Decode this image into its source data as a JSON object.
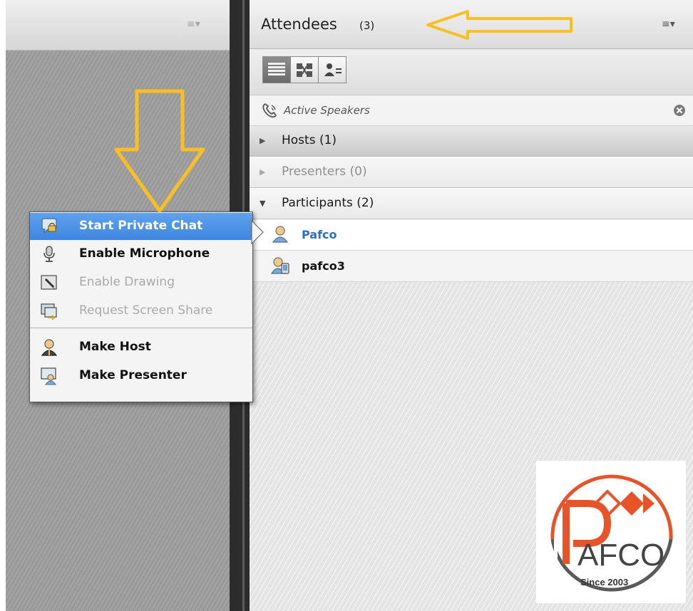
{
  "left_pod": {
    "menu_icon": "pod-menu-icon"
  },
  "attendees_pod": {
    "title": "Attendees",
    "count": "(3)",
    "menu_icon": "pod-menu-icon",
    "view_buttons": [
      "list-view-icon",
      "breakout-view-icon",
      "status-view-icon"
    ],
    "active_speakers": {
      "label": "Active Speakers",
      "icon": "phone-icon",
      "close_icon": "close-icon"
    },
    "groups": [
      {
        "label": "Hosts (1)",
        "expanded": false
      },
      {
        "label": "Presenters (0)",
        "expanded": false,
        "disabled": true
      },
      {
        "label": "Participants (2)",
        "expanded": true
      }
    ],
    "participants": [
      {
        "name": "Pafco",
        "selected": true,
        "color": "#2a6fc9"
      },
      {
        "name": "pafco3",
        "selected": false,
        "color": "#111111"
      }
    ]
  },
  "context_menu": {
    "items": [
      {
        "label": "Start Private Chat",
        "icon": "private-chat-icon",
        "highlighted": true,
        "enabled": true
      },
      {
        "label": "Enable Microphone",
        "icon": "microphone-icon",
        "enabled": true
      },
      {
        "label": "Enable Drawing",
        "icon": "drawing-icon",
        "enabled": false
      },
      {
        "label": "Request Screen Share",
        "icon": "screen-share-icon",
        "enabled": false
      },
      {
        "label": "Make Host",
        "icon": "host-icon",
        "enabled": true
      },
      {
        "label": "Make Presenter",
        "icon": "presenter-icon",
        "enabled": true
      }
    ]
  },
  "logo": {
    "text": "AFCO",
    "tagline": "Since 2003",
    "brand_color": "#e8542a"
  },
  "annotation_color": "#fbbf24"
}
